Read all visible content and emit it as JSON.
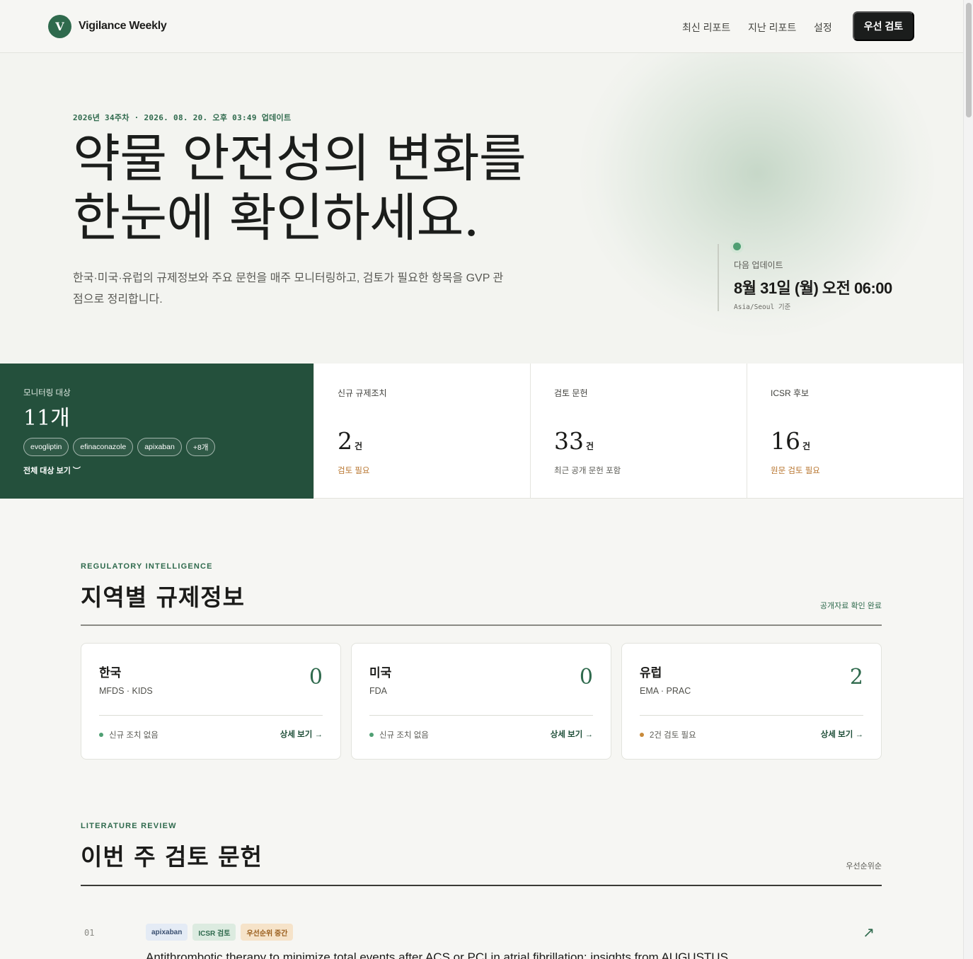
{
  "header": {
    "logo_letter": "V",
    "brand": "Vigilance Weekly",
    "nav": [
      "최신 리포트",
      "지난 리포트",
      "설정"
    ],
    "cta": "우선 검토"
  },
  "hero": {
    "eyebrow": "2026년 34주차 · 2026. 08. 20. 오후 03:49 업데이트",
    "title_line1": "약물 안전성의 변화를",
    "title_line2": "한눈에 확인하세요.",
    "description": "한국·미국·유럽의 규제정보와 주요 문헌을 매주 모니터링하고, 검토가 필요한 항목을 GVP 관점으로 정리합니다.",
    "next_update": {
      "label": "다음 업데이트",
      "time": "8월 31일 (월) 오전 06:00",
      "timezone": "Asia/Seoul 기준"
    }
  },
  "stats": {
    "monitor": {
      "label": "모니터링 대상",
      "count": "11개",
      "chips": [
        "evogliptin",
        "efinaconazole",
        "apixaban",
        "+8개"
      ],
      "link": "전체 대상 보기 ︶"
    },
    "cards": [
      {
        "label": "신규 규제조치",
        "value": "2",
        "unit": "건",
        "note": "검토 필요"
      },
      {
        "label": "검토 문헌",
        "value": "33",
        "unit": "건",
        "note": "최근 공개 문헌 포함"
      },
      {
        "label": "ICSR 후보",
        "value": "16",
        "unit": "건",
        "note": "원문 검토 필요"
      }
    ],
    "colors": {
      "panel": "#24503c",
      "warn": "#b8752f"
    }
  },
  "regulatory": {
    "eyebrow": "REGULATORY INTELLIGENCE",
    "title": "지역별 규제정보",
    "meta": "공개자료 확인 완료",
    "regions": [
      {
        "name": "한국",
        "agency": "MFDS · KIDS",
        "count": "0",
        "status": "신규 조치 없음",
        "link": "상세 보기 →",
        "status_color": "#4f9f73"
      },
      {
        "name": "미국",
        "agency": "FDA",
        "count": "0",
        "status": "신규 조치 없음",
        "link": "상세 보기 →",
        "status_color": "#4f9f73"
      },
      {
        "name": "유럽",
        "agency": "EMA · PRAC",
        "count": "2",
        "status": "2건 검토 필요",
        "link": "상세 보기 →",
        "status_color": "#c88a3a"
      }
    ]
  },
  "literature": {
    "eyebrow": "LITERATURE REVIEW",
    "title": "이번 주 검토 문헌",
    "meta": "우선순위순",
    "items": [
      {
        "index": "01",
        "tags": [
          "apixaban",
          "ICSR 검토",
          "우선순위 중간"
        ],
        "title": "Antithrombotic therapy to minimize total events after ACS or PCI in atrial fibrillation: insights from AUGUSTUS",
        "arrow": "↗"
      }
    ]
  }
}
